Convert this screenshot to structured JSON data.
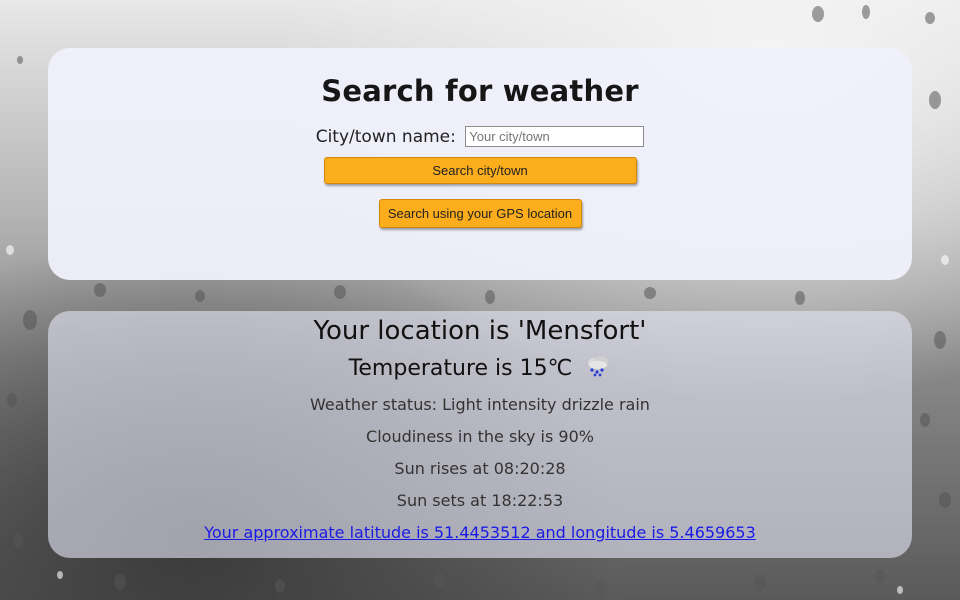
{
  "search": {
    "title": "Search for weather",
    "city_label": "City/town name:",
    "city_placeholder": "Your city/town",
    "city_value": "",
    "search_button": "Search city/town",
    "gps_button": "Search using your GPS location"
  },
  "result": {
    "location": "Your location is 'Mensfort'",
    "temperature": "Temperature is 15℃",
    "weather_icon": "rain-cloud-icon",
    "status": "Weather status: Light intensity drizzle rain",
    "cloudiness": "Cloudiness in the sky is 90%",
    "sunrise": "Sun rises at 08:20:28",
    "sunset": "Sun sets at 18:22:53",
    "coordinates_link": "Your approximate latitude is 51.4453512 and longitude is 5.4659653"
  },
  "colors": {
    "button": "#fbad1c",
    "link": "#1a1ae6",
    "card": "#f0f0fc"
  }
}
